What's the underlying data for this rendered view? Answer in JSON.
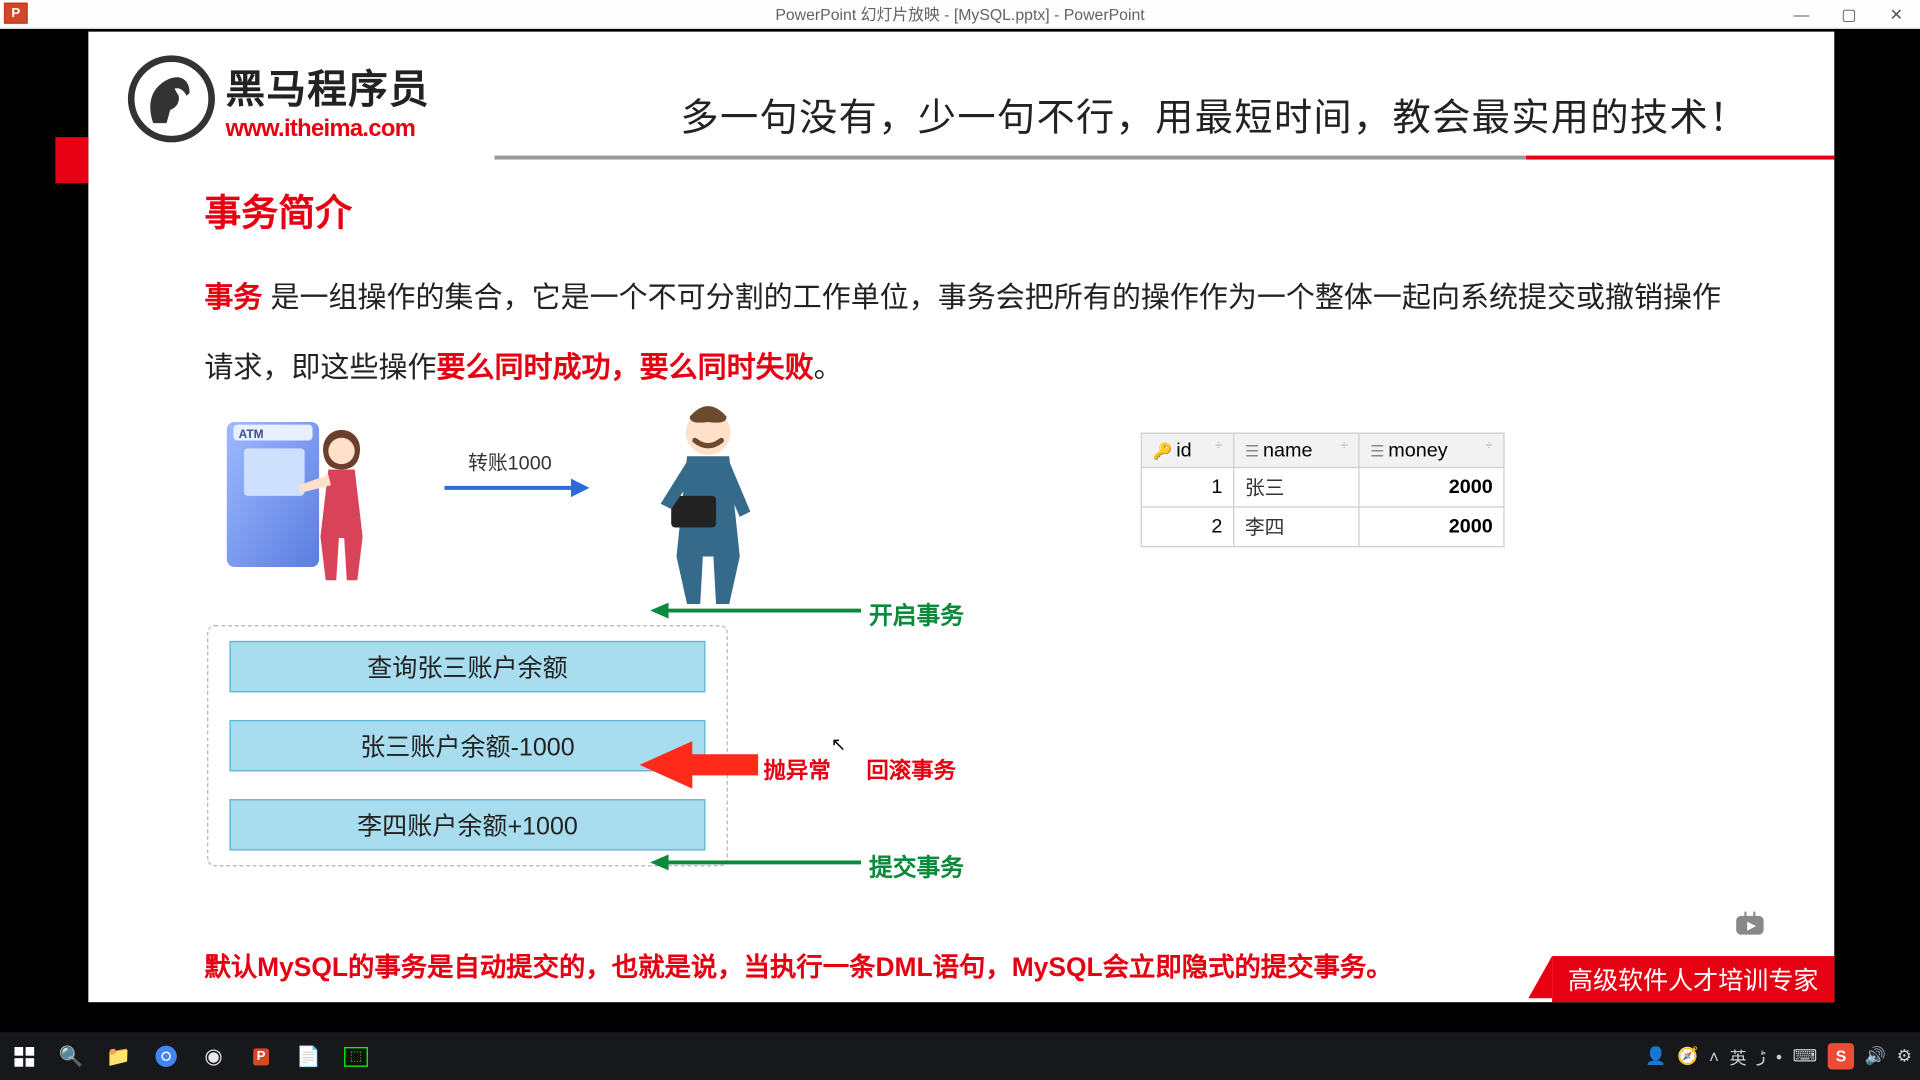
{
  "titlebar": {
    "text": "PowerPoint 幻灯片放映 - [MySQL.pptx] - PowerPoint"
  },
  "logo": {
    "cn": "黑马程序员",
    "url": "www.itheima.com"
  },
  "tagline": "多一句没有，少一句不行，用最短时间，教会最实用的技术！",
  "slide": {
    "title": "事务简介",
    "p_kw1": "事务",
    "p_seg1": " 是一组操作的集合，它是一个不可分割的工作单位，事务会把所有的操作作为一个整体一起向系统提交或撤销操作",
    "p_seg2": "请求，即这些操作",
    "p_kw2": "要么同时成功，要么同时失败",
    "p_seg3": "。"
  },
  "transfer": {
    "label": "转账1000"
  },
  "steps": [
    "查询张三账户余额",
    "张三账户余额-1000",
    "李四账户余额+1000"
  ],
  "labels": {
    "begin": "开启事务",
    "throw": "抛异常",
    "rollback": "回滚事务",
    "commit": "提交事务"
  },
  "table": {
    "cols": {
      "id": "id",
      "name": "name",
      "money": "money"
    },
    "rows": [
      {
        "id": "1",
        "name": "张三",
        "money": "2000"
      },
      {
        "id": "2",
        "name": "李四",
        "money": "2000"
      }
    ]
  },
  "footnote": "默认MySQL的事务是自动提交的，也就是说，当执行一条DML语句，MySQL会立即隐式的提交事务。",
  "banner": "高级软件人才培训专家",
  "tray": {
    "ime": "英"
  }
}
